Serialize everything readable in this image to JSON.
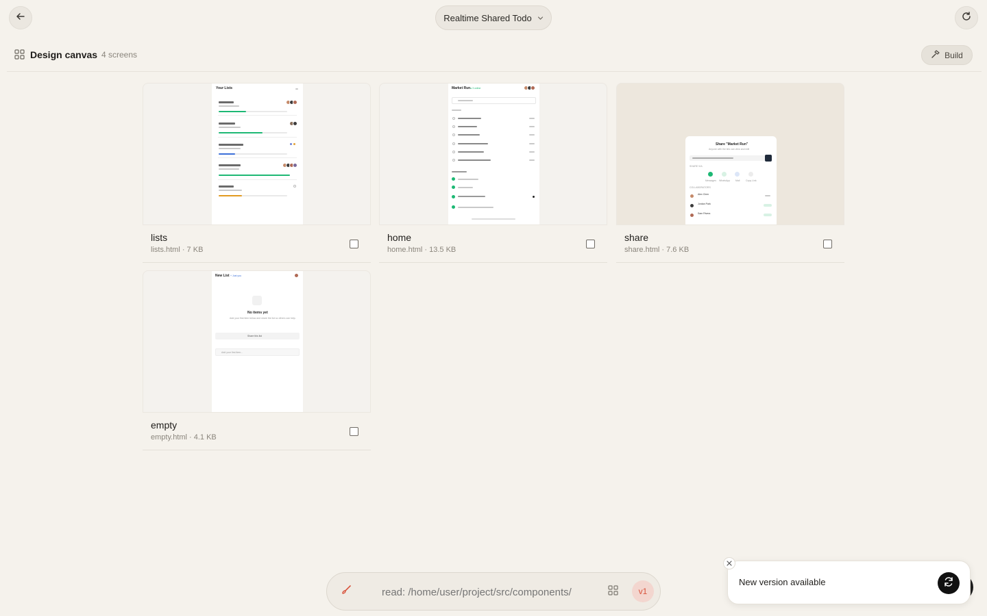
{
  "topbar": {
    "project_name": "Realtime Shared Todo"
  },
  "canvas": {
    "title": "Design canvas",
    "count": "4 screens",
    "build_label": "Build"
  },
  "screens": [
    {
      "name": "lists",
      "meta": "lists.html · 7 KB"
    },
    {
      "name": "home",
      "meta": "home.html · 13.5 KB"
    },
    {
      "name": "share",
      "meta": "share.html · 7.6 KB"
    },
    {
      "name": "empty",
      "meta": "empty.html · 4.1 KB"
    }
  ],
  "thumbs": {
    "lists_title": "Your Lists",
    "home_title": "Market Run",
    "home_live": "● 3 online",
    "share_title": "Share \"Market Run\"",
    "share_sub": "Anyone with the link can view and edit",
    "share_via": "SHARE VIA",
    "share_options": [
      "Messages",
      "WhatsApp",
      "Mail",
      "Copy Link"
    ],
    "collaborators_label": "COLLABORATORS",
    "collaborators": [
      "Alex Chen",
      "Jordan Park",
      "Sam Rivera"
    ],
    "empty_title": "New List",
    "empty_badge": "+ Just you",
    "empty_heading": "No items yet",
    "empty_desc": "Add your first item below and share the list so others can help.",
    "empty_share": "Share this list",
    "empty_input": "Add your first item..."
  },
  "prompt": {
    "placeholder": "read: /home/user/project/src/components/",
    "version": "v1"
  },
  "toast": {
    "message": "New version available"
  },
  "colors": {
    "accent_green": "#1db874",
    "accent_orange": "#e29a1f",
    "accent_blue": "#3b6fd8",
    "version_red": "#d8523b"
  }
}
